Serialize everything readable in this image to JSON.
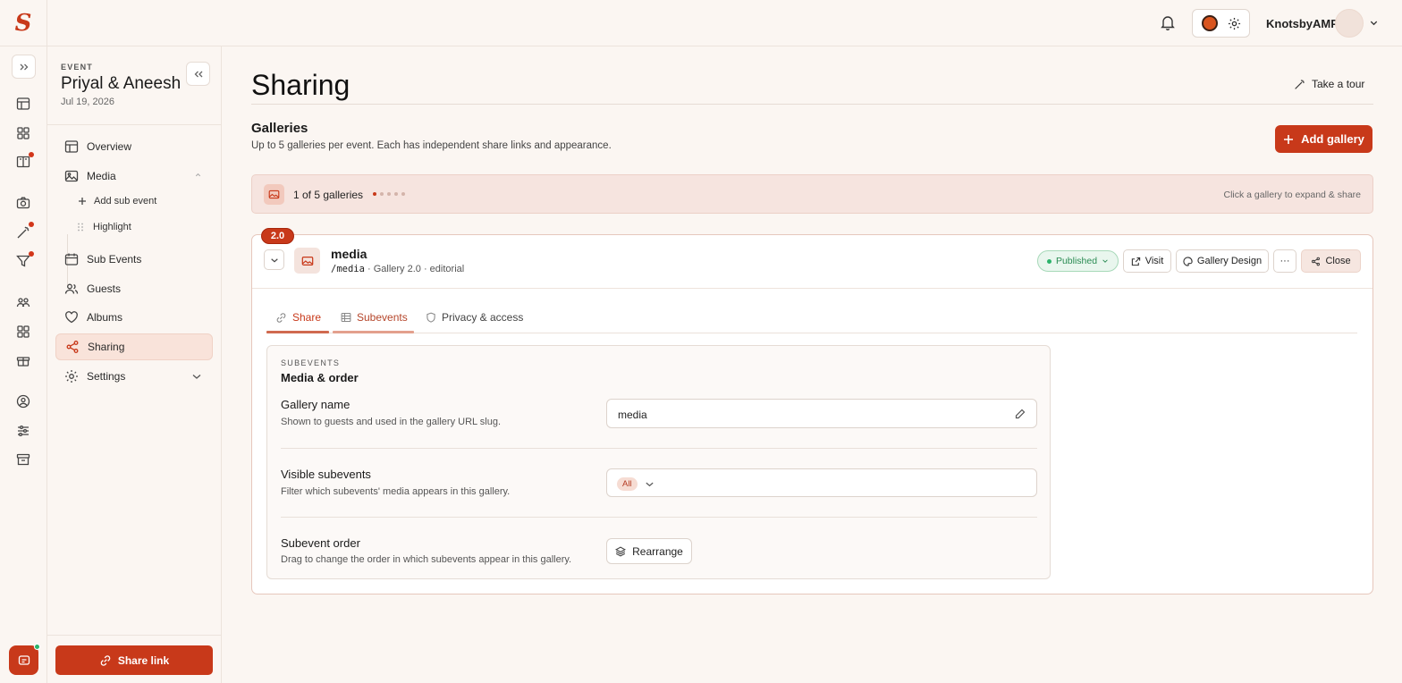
{
  "brand": {
    "logo_letter": "S",
    "color": "#c8391a"
  },
  "topbar": {
    "username": "KnotsbyAMP"
  },
  "event": {
    "kicker": "EVENT",
    "title": "Priyal & Aneesh",
    "date": "Jul 19, 2026"
  },
  "sidebar": {
    "items": [
      {
        "label": "Overview"
      },
      {
        "label": "Media"
      },
      {
        "label": "Sub Events"
      },
      {
        "label": "Guests"
      },
      {
        "label": "Albums"
      },
      {
        "label": "Sharing"
      },
      {
        "label": "Settings"
      }
    ],
    "media_sub": [
      {
        "label": "Add sub event"
      },
      {
        "label": "Highlight"
      }
    ],
    "share_link_label": "Share link"
  },
  "page": {
    "title": "Sharing",
    "tour_label": "Take a tour",
    "galleries_heading": "Galleries",
    "galleries_sub": "Up to 5 galleries per event. Each has independent share links and appearance.",
    "add_gallery_label": "Add gallery",
    "count_text": "1 of 5 galleries",
    "count_used": 1,
    "count_max": 5,
    "count_hint": "Click a gallery to expand & share"
  },
  "gallery": {
    "version": "2.0",
    "name": "media",
    "slug": "/media",
    "meta": " · Gallery 2.0 · editorial",
    "status": "Published",
    "visit_label": "Visit",
    "design_label": "Gallery Design",
    "more_label": "···",
    "close_label": "Close"
  },
  "tabs": [
    {
      "label": "Share"
    },
    {
      "label": "Subevents"
    },
    {
      "label": "Privacy & access"
    }
  ],
  "panel": {
    "kicker": "SUBEVENTS",
    "title": "Media & order",
    "name_label": "Gallery name",
    "name_desc": "Shown to guests and used in the gallery URL slug.",
    "name_value": "media",
    "visible_label": "Visible subevents",
    "visible_desc": "Filter which subevents' media appears in this gallery.",
    "visible_value": "All",
    "order_label": "Subevent order",
    "order_desc": "Drag to change the order in which subevents appear in this gallery.",
    "rearrange_label": "Rearrange"
  },
  "colors": {
    "accent": "#c8391a",
    "published": "#2a8b53",
    "active_nav": "#f9e3da"
  }
}
